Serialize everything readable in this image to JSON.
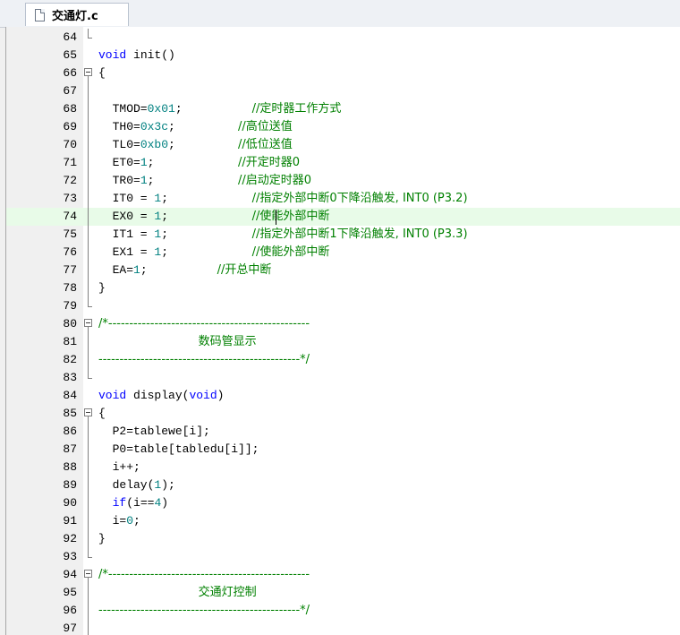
{
  "tab": {
    "filename": "交通灯.c"
  },
  "lines": [
    {
      "no": "64",
      "fold": "end",
      "tokens": []
    },
    {
      "no": "65",
      "fold": "none",
      "tokens": [
        [
          "kw",
          "void"
        ],
        [
          "t",
          " init()"
        ]
      ]
    },
    {
      "no": "66",
      "fold": "open",
      "tokens": [
        [
          "t",
          "{"
        ]
      ]
    },
    {
      "no": "67",
      "fold": "line",
      "tokens": []
    },
    {
      "no": "68",
      "fold": "line",
      "tokens": [
        [
          "t",
          "  TMOD="
        ],
        [
          "num",
          "0x01"
        ],
        [
          "t",
          ";          "
        ],
        [
          "cm",
          "//定时器工作方式"
        ]
      ]
    },
    {
      "no": "69",
      "fold": "line",
      "tokens": [
        [
          "t",
          "  TH0="
        ],
        [
          "num",
          "0x3c"
        ],
        [
          "t",
          ";         "
        ],
        [
          "cm",
          "//高位送值"
        ]
      ]
    },
    {
      "no": "70",
      "fold": "line",
      "tokens": [
        [
          "t",
          "  TL0="
        ],
        [
          "num",
          "0xb0"
        ],
        [
          "t",
          ";         "
        ],
        [
          "cm",
          "//低位送值"
        ]
      ]
    },
    {
      "no": "71",
      "fold": "line",
      "tokens": [
        [
          "t",
          "  ET0="
        ],
        [
          "num",
          "1"
        ],
        [
          "t",
          ";            "
        ],
        [
          "cm",
          "//开定时器0"
        ]
      ]
    },
    {
      "no": "72",
      "fold": "line",
      "tokens": [
        [
          "t",
          "  TR0="
        ],
        [
          "num",
          "1"
        ],
        [
          "t",
          ";            "
        ],
        [
          "cm",
          "//启动定时器0"
        ]
      ]
    },
    {
      "no": "73",
      "fold": "line",
      "tokens": [
        [
          "t",
          "  IT0 = "
        ],
        [
          "num",
          "1"
        ],
        [
          "t",
          ";            "
        ],
        [
          "cm",
          "//指定外部中断0下降沿触发, INT0 (P3.2)"
        ]
      ]
    },
    {
      "no": "74",
      "fold": "line",
      "hl": true,
      "tokens": [
        [
          "t",
          "  EX0 = "
        ],
        [
          "num",
          "1"
        ],
        [
          "t",
          ";            "
        ],
        [
          "cm",
          "//使能外部中断"
        ]
      ]
    },
    {
      "no": "75",
      "fold": "line",
      "tokens": [
        [
          "t",
          "  IT1 = "
        ],
        [
          "num",
          "1"
        ],
        [
          "t",
          ";            "
        ],
        [
          "cm",
          "//指定外部中断1下降沿触发, INT0 (P3.3)"
        ]
      ]
    },
    {
      "no": "76",
      "fold": "line",
      "tokens": [
        [
          "t",
          "  EX1 = "
        ],
        [
          "num",
          "1"
        ],
        [
          "t",
          ";            "
        ],
        [
          "cm",
          "//使能外部中断"
        ]
      ]
    },
    {
      "no": "77",
      "fold": "line",
      "tokens": [
        [
          "t",
          "  EA="
        ],
        [
          "num",
          "1"
        ],
        [
          "t",
          ";          "
        ],
        [
          "cm",
          "//开总中断"
        ]
      ]
    },
    {
      "no": "78",
      "fold": "line",
      "tokens": [
        [
          "t",
          "}"
        ]
      ]
    },
    {
      "no": "79",
      "fold": "end",
      "tokens": []
    },
    {
      "no": "80",
      "fold": "open",
      "tokens": [
        [
          "cm",
          "/*------------------------------------------------"
        ]
      ]
    },
    {
      "no": "81",
      "fold": "line",
      "tokens": [
        [
          "cm",
          "                           数码管显示"
        ]
      ]
    },
    {
      "no": "82",
      "fold": "line",
      "tokens": [
        [
          "cm",
          "------------------------------------------------*/"
        ]
      ]
    },
    {
      "no": "83",
      "fold": "end",
      "tokens": []
    },
    {
      "no": "84",
      "fold": "none",
      "tokens": [
        [
          "kw",
          "void"
        ],
        [
          "t",
          " display("
        ],
        [
          "kw",
          "void"
        ],
        [
          "t",
          ")"
        ]
      ]
    },
    {
      "no": "85",
      "fold": "open",
      "tokens": [
        [
          "t",
          "{"
        ]
      ]
    },
    {
      "no": "86",
      "fold": "line",
      "tokens": [
        [
          "t",
          "  P2=tablewe[i];"
        ]
      ]
    },
    {
      "no": "87",
      "fold": "line",
      "tokens": [
        [
          "t",
          "  P0=table[tabledu[i]];"
        ]
      ]
    },
    {
      "no": "88",
      "fold": "line",
      "tokens": [
        [
          "t",
          "  i++;"
        ]
      ]
    },
    {
      "no": "89",
      "fold": "line",
      "tokens": [
        [
          "t",
          "  delay("
        ],
        [
          "num",
          "1"
        ],
        [
          "t",
          ");"
        ]
      ]
    },
    {
      "no": "90",
      "fold": "line",
      "tokens": [
        [
          "t",
          "  "
        ],
        [
          "kw",
          "if"
        ],
        [
          "t",
          "(i=="
        ],
        [
          "num",
          "4"
        ],
        [
          "t",
          ")"
        ]
      ]
    },
    {
      "no": "91",
      "fold": "line",
      "tokens": [
        [
          "t",
          "  i="
        ],
        [
          "num",
          "0"
        ],
        [
          "t",
          ";"
        ]
      ]
    },
    {
      "no": "92",
      "fold": "line",
      "tokens": [
        [
          "t",
          "}"
        ]
      ]
    },
    {
      "no": "93",
      "fold": "end",
      "tokens": []
    },
    {
      "no": "94",
      "fold": "open",
      "tokens": [
        [
          "cm",
          "/*------------------------------------------------"
        ]
      ]
    },
    {
      "no": "95",
      "fold": "line",
      "tokens": [
        [
          "cm",
          "                           交通灯控制"
        ]
      ]
    },
    {
      "no": "96",
      "fold": "line",
      "tokens": [
        [
          "cm",
          "------------------------------------------------*/"
        ]
      ]
    },
    {
      "no": "97",
      "fold": "line",
      "tokens": []
    }
  ]
}
